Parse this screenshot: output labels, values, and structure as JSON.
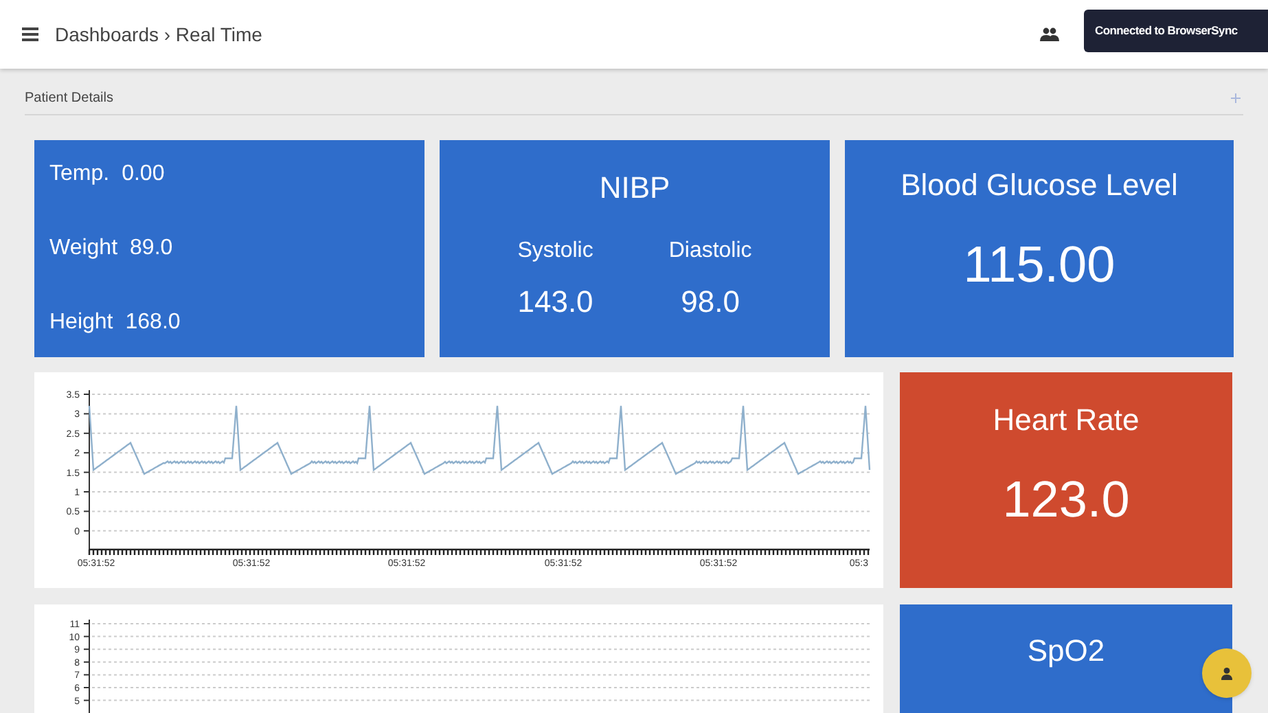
{
  "header": {
    "breadcrumb": "Dashboards › Real Time",
    "toast": "Connected to BrowserSync"
  },
  "section": {
    "title": "Patient Details"
  },
  "vitals": [
    {
      "label": "Temp.",
      "value": "0.00"
    },
    {
      "label": "Weight",
      "value": "89.0"
    },
    {
      "label": "Height",
      "value": "168.0"
    }
  ],
  "nibp": {
    "title": "NIBP",
    "readings": [
      {
        "label": "Systolic",
        "value": "143.0"
      },
      {
        "label": "Diastolic",
        "value": "98.0"
      }
    ]
  },
  "glucose": {
    "title": "Blood Glucose Level",
    "value": "115.00"
  },
  "ecg_chart": {
    "yticks": [
      "3.5",
      "3",
      "2.5",
      "2",
      "1.5",
      "1",
      "0.5",
      "0"
    ],
    "xlabels": [
      "05:31:52",
      "05:31:52",
      "05:31:52",
      "05:31:52",
      "05:31:52",
      "05:3"
    ]
  },
  "heart_rate": {
    "title": "Heart Rate",
    "value": "123.0",
    "color": "#cf4a2e"
  },
  "second_chart": {
    "yticks": [
      "11",
      "10",
      "9",
      "8",
      "7",
      "6",
      "5"
    ]
  },
  "spo2": {
    "title": "SpO2",
    "color": "#2f6dcb"
  }
}
